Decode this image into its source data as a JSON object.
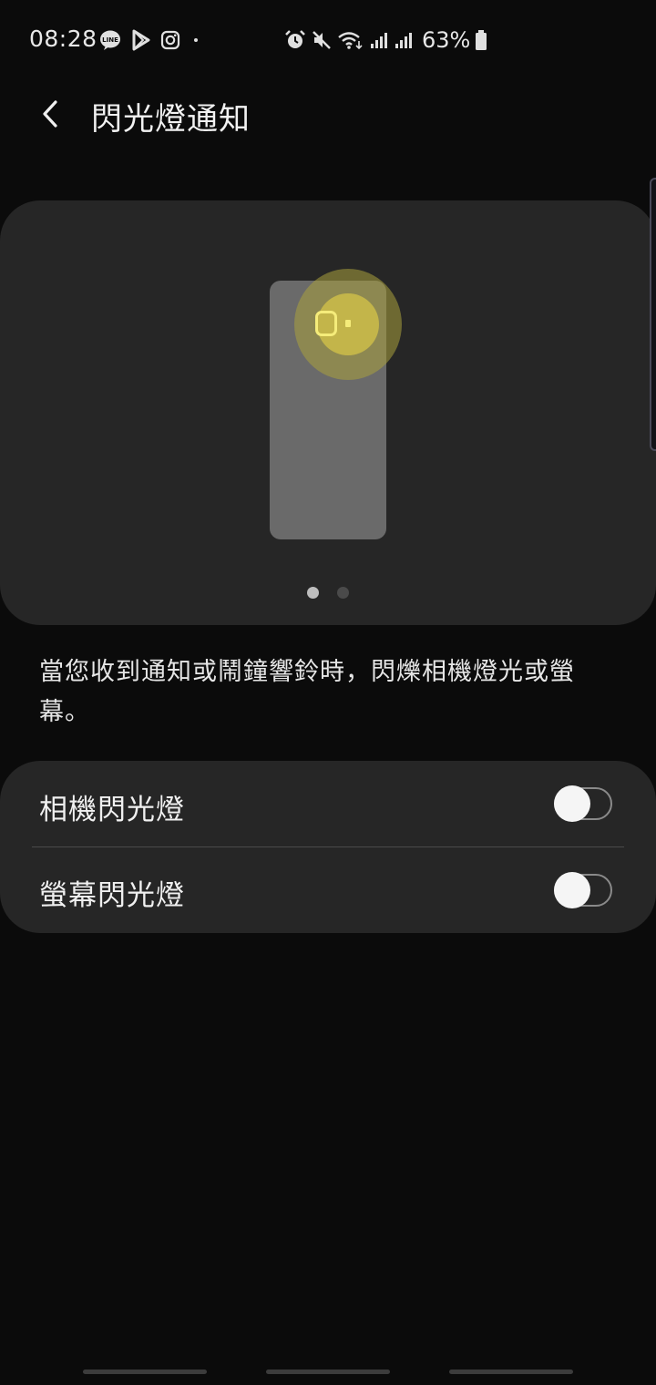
{
  "status_bar": {
    "time": "08:28",
    "battery_percent": "63%",
    "left_icons": [
      "line-icon",
      "play-store-icon",
      "instagram-icon",
      "dot-icon"
    ],
    "right_icons": [
      "alarm-icon",
      "mute-icon",
      "wifi-icon",
      "signal-icon",
      "signal-icon"
    ]
  },
  "header": {
    "title": "閃光燈通知"
  },
  "preview": {
    "pages": 2,
    "active_page": 1,
    "glow_color": "#c3b54a"
  },
  "description": "當您收到通知或鬧鐘響鈴時，閃爍相機燈光或螢幕。",
  "settings": [
    {
      "label": "相機閃光燈",
      "enabled": false
    },
    {
      "label": "螢幕閃光燈",
      "enabled": false
    }
  ]
}
